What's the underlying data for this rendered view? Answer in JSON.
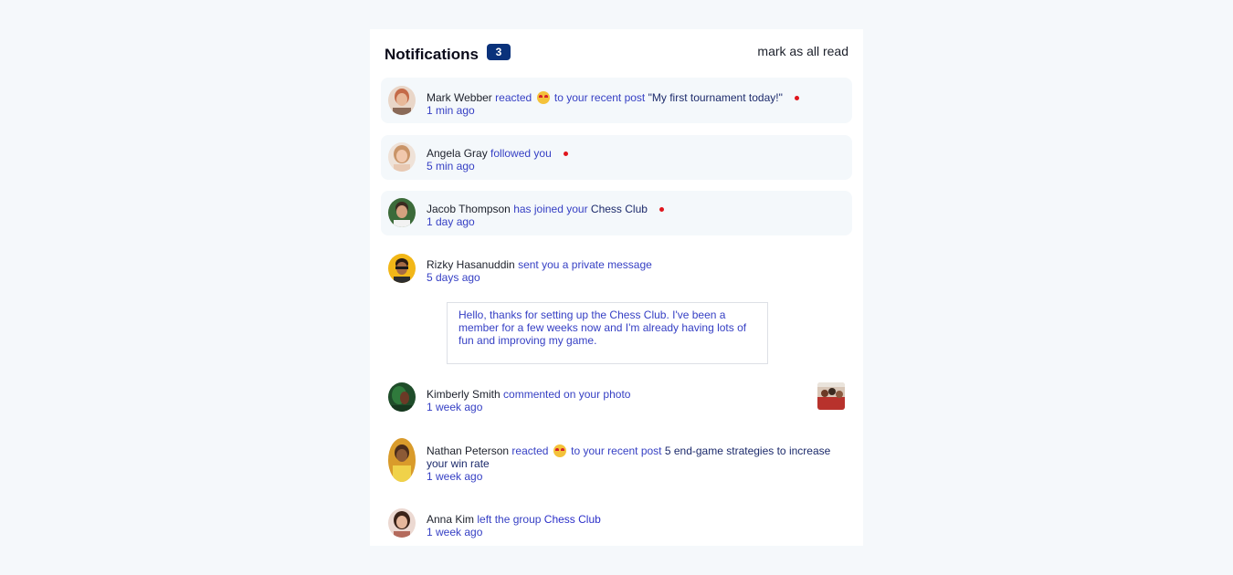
{
  "header": {
    "title": "Notifications",
    "count": "3",
    "mark_all_read": "mark as all read"
  },
  "notifications": [
    {
      "name": "Mark Webber",
      "verb": "reacted",
      "verb_after": "to your recent post",
      "target": "\"My first tournament today!\"",
      "time": "1 min ago",
      "unread": true
    },
    {
      "name": "Angela Gray",
      "verb": "followed you",
      "time": "5 min ago",
      "unread": true
    },
    {
      "name": "Jacob Thompson",
      "verb": "has joined your",
      "target": "Chess Club",
      "time": "1 day ago",
      "unread": true
    },
    {
      "name": "Rizky Hasanuddin",
      "verb": "sent you a private message",
      "time": "5 days ago",
      "message": "Hello, thanks for setting up the Chess Club. I've been a member for a few weeks now and I'm already having lots of fun and improving my game."
    },
    {
      "name": "Kimberly Smith",
      "verb": "commented on your photo",
      "time": "1 week ago"
    },
    {
      "name": "Nathan Peterson",
      "verb": "reacted",
      "verb_after": "to your recent post",
      "target": "5 end-game strategies to increase your win rate",
      "time": "1 week ago"
    },
    {
      "name": "Anna Kim",
      "verb": "left the group",
      "target": "Chess Club",
      "time": "1 week ago"
    }
  ],
  "colors": {
    "accent": "#0a327b",
    "unread_dot": "#e0161d",
    "unread_bg": "#f4f8fb",
    "link": "#3640c4"
  },
  "icons": {
    "reaction": "heart-eyes-emoji-icon"
  }
}
